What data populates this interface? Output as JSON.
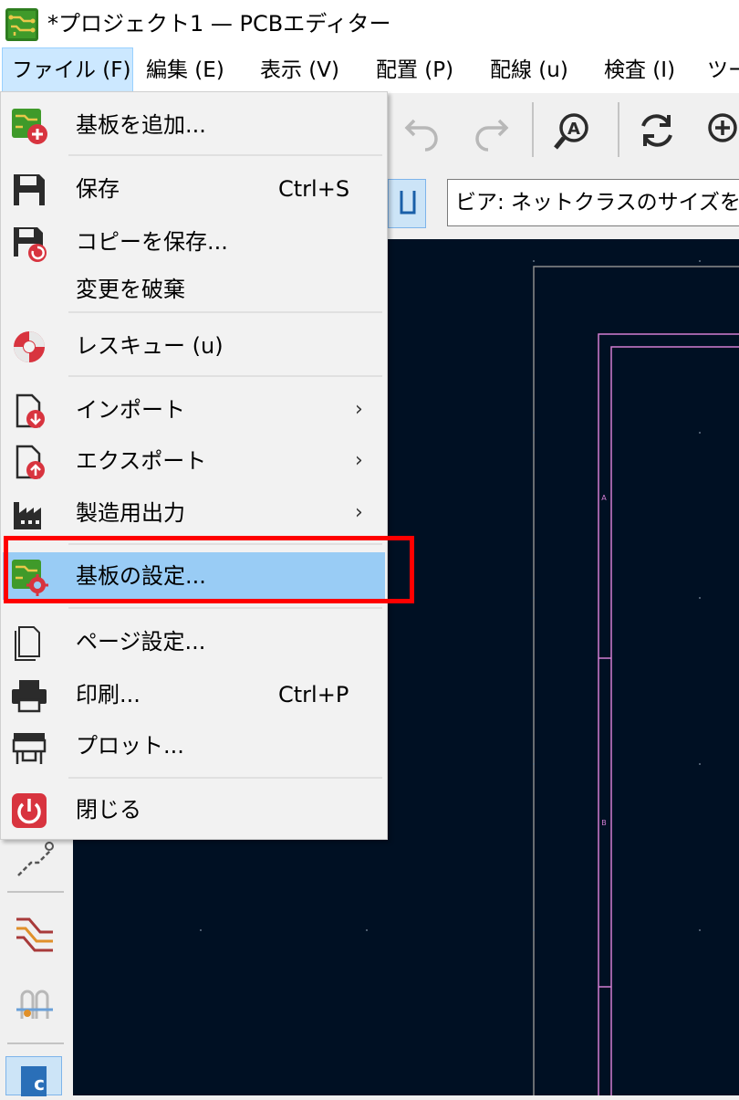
{
  "window": {
    "title": "*プロジェクト1 — PCBエディター"
  },
  "menubar": {
    "items": [
      {
        "id": "file",
        "label": "ファイル (F)"
      },
      {
        "id": "edit",
        "label": "編集 (E)"
      },
      {
        "id": "view",
        "label": "表示 (V)"
      },
      {
        "id": "place",
        "label": "配置 (P)"
      },
      {
        "id": "route",
        "label": "配線 (u)"
      },
      {
        "id": "inspect",
        "label": "検査 (I)"
      },
      {
        "id": "tools",
        "label": "ツー"
      }
    ]
  },
  "toolbar": {
    "via_select_value": "ビア: ネットクラスのサイズを使"
  },
  "file_menu": {
    "items": [
      {
        "name": "add-board",
        "label": "基板を追加...",
        "icon": "board-add-icon"
      },
      {
        "name": "save",
        "label": "保存",
        "shortcut": "Ctrl+S",
        "icon": "save-icon"
      },
      {
        "name": "save-copy",
        "label": "コピーを保存...",
        "icon": "save-copy-icon"
      },
      {
        "name": "revert",
        "label": "変更を破棄"
      },
      {
        "name": "rescue",
        "label": "レスキュー (u)",
        "icon": "rescue-icon"
      },
      {
        "name": "import",
        "label": "インポート",
        "submenu": "›",
        "icon": "import-icon"
      },
      {
        "name": "export",
        "label": "エクスポート",
        "submenu": "›",
        "icon": "export-icon"
      },
      {
        "name": "fab-outputs",
        "label": "製造用出力",
        "submenu": "›",
        "icon": "factory-icon"
      },
      {
        "name": "board-setup",
        "label": "基板の設定...",
        "icon": "board-setup-icon"
      },
      {
        "name": "page-settings",
        "label": "ページ設定...",
        "icon": "page-icon"
      },
      {
        "name": "print",
        "label": "印刷...",
        "shortcut": "Ctrl+P",
        "icon": "printer-icon"
      },
      {
        "name": "plot",
        "label": "プロット...",
        "icon": "plotter-icon"
      },
      {
        "name": "close",
        "label": "閉じる",
        "icon": "power-icon"
      }
    ]
  },
  "colors": {
    "canvas_bg": "#001023",
    "highlight": "#99ccf5",
    "annotation_box": "#ff0000",
    "board_outline": "#d27dd2",
    "sheet_border": "#8c8c8c"
  }
}
